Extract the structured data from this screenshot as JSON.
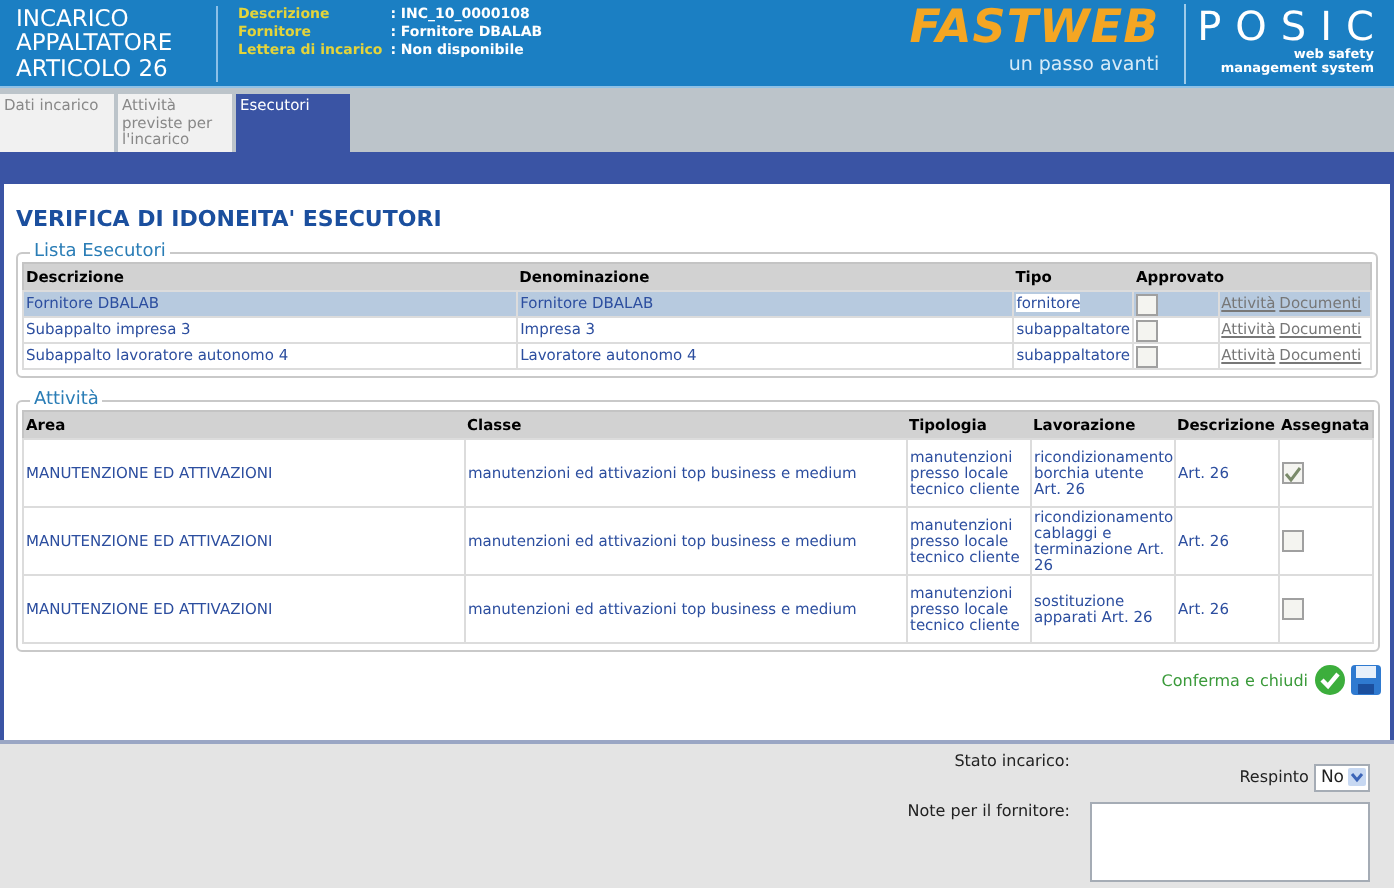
{
  "header": {
    "title": "INCARICO APPALTATORE ARTICOLO 26",
    "info": [
      {
        "label": "Descrizione",
        "value": ": INC_10_0000108"
      },
      {
        "label": "Fornitore",
        "value": ": Fornitore DBALAB"
      },
      {
        "label": "Lettera di incarico",
        "value": ": Non disponibile"
      }
    ],
    "brand": "FASTWEB",
    "tagline": "un passo avanti",
    "product": "POSIC",
    "product_lines": [
      "web safety",
      "management system"
    ]
  },
  "tabs": [
    {
      "label": "Dati incarico",
      "selected": false
    },
    {
      "label": "Attività previste per l'incarico",
      "selected": false
    },
    {
      "label": "Esecutori",
      "selected": true
    }
  ],
  "page_title": "VERIFICA DI IDONEITA' ESECUTORI",
  "esecutori": {
    "legend": "Lista Esecutori",
    "columns": [
      "Descrizione",
      "Denominazione",
      "Tipo",
      "Approvato"
    ],
    "rows": [
      {
        "descrizione": "Fornitore DBALAB",
        "denominazione": "Fornitore DBALAB",
        "tipo": "fornitore",
        "approvato": false,
        "links": [
          "Attività",
          "Documenti"
        ],
        "selected": true
      },
      {
        "descrizione": "Subappalto impresa 3",
        "denominazione": "Impresa 3",
        "tipo": "subappaltatore",
        "approvato": false,
        "links": [
          "Attività",
          "Documenti"
        ],
        "selected": false
      },
      {
        "descrizione": "Subappalto lavoratore autonomo 4",
        "denominazione": "Lavoratore autonomo 4",
        "tipo": "subappaltatore",
        "approvato": false,
        "links": [
          "Attività",
          "Documenti"
        ],
        "selected": false
      }
    ]
  },
  "attivita": {
    "legend": "Attività",
    "columns": [
      "Area",
      "Classe",
      "Tipologia",
      "Lavorazione",
      "Descrizione",
      "Assegnata"
    ],
    "rows": [
      {
        "area": "MANUTENZIONE ED ATTIVAZIONI",
        "classe": "manutenzioni ed attivazioni top business e medium",
        "tipologia": "manutenzioni presso locale tecnico cliente",
        "lavorazione": "ricondizionamento borchia utente Art. 26",
        "descrizione": "Art. 26",
        "assegnata": true
      },
      {
        "area": "MANUTENZIONE ED ATTIVAZIONI",
        "classe": "manutenzioni ed attivazioni top business e medium",
        "tipologia": "manutenzioni presso locale tecnico cliente",
        "lavorazione": "ricondizionamento cablaggi e terminazione Art. 26",
        "descrizione": "Art. 26",
        "assegnata": false
      },
      {
        "area": "MANUTENZIONE ED ATTIVAZIONI",
        "classe": "manutenzioni ed attivazioni top business e medium",
        "tipologia": "manutenzioni presso locale tecnico cliente",
        "lavorazione": "sostituzione apparati Art. 26",
        "descrizione": "Art. 26",
        "assegnata": false
      }
    ]
  },
  "confirm": "Conferma e chiudi",
  "footer": {
    "status_label": "Stato incarico:",
    "status_option": "Respinto",
    "status_value": "No",
    "notes_label": "Note per il fornitore:"
  }
}
